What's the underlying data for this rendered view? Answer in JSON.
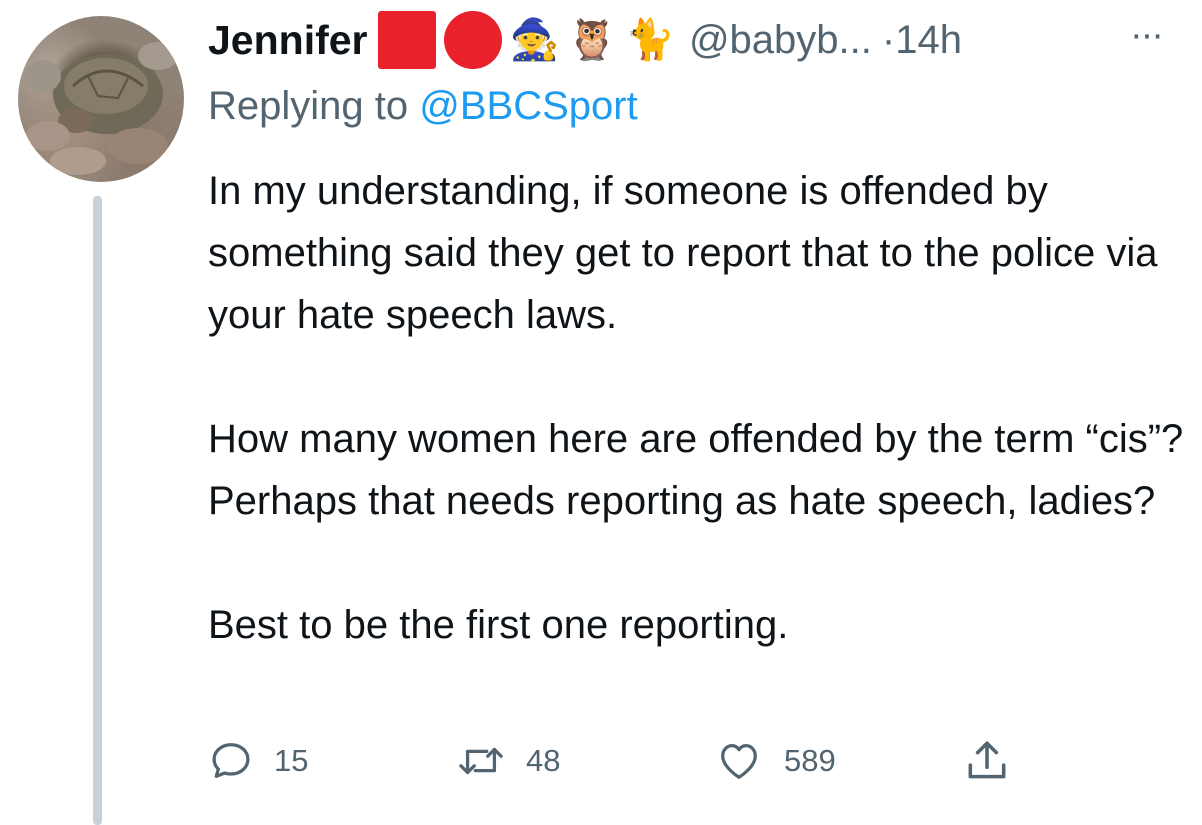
{
  "tweet": {
    "author_name": "Jennifer",
    "flair_emojis": [
      "🧙",
      "🦉",
      "🐈"
    ],
    "handle": "@babyb...",
    "separator": "·",
    "time": "14h",
    "more": "···",
    "replying_label": "Replying to ",
    "replying_mention": "@BBCSport",
    "paragraphs": [
      "In my understanding, if someone is offended by something said they get to report that to the police via your hate speech laws.",
      "How many women here are offended by the term “cis”?  Perhaps that needs reporting as hate speech, ladies?",
      "Best to be the first one reporting."
    ],
    "counts": {
      "replies": "15",
      "retweets": "48",
      "likes": "589"
    }
  },
  "colors": {
    "text": "#0f1419",
    "muted": "#536471",
    "accent": "#1d9bf0",
    "flair_red": "#e8212b",
    "thread_line": "#c6d1da"
  },
  "icons": [
    "reply-icon",
    "retweet-icon",
    "like-icon",
    "share-icon"
  ]
}
